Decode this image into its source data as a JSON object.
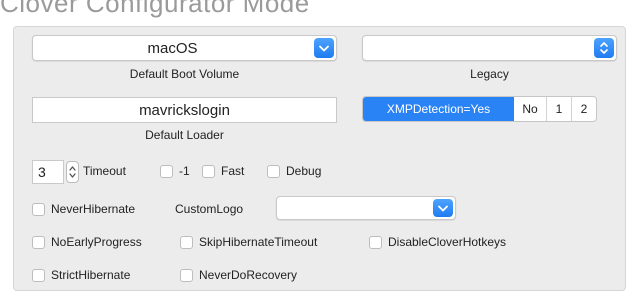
{
  "window": {
    "title": "Clover Configurator Mode"
  },
  "boot": {
    "volume_value": "macOS",
    "volume_caption": "Default Boot Volume",
    "legacy_value": "",
    "legacy_caption": "Legacy",
    "loader_value": "mavrickslogin",
    "loader_caption": "Default Loader"
  },
  "xmp": {
    "options": [
      "XMPDetection=Yes",
      "No",
      "1",
      "2"
    ],
    "selected": "XMPDetection=Yes"
  },
  "timeout": {
    "value": "3",
    "label": "Timeout",
    "minus_one_label": "-1",
    "fast_label": "Fast",
    "debug_label": "Debug"
  },
  "options": {
    "never_hibernate": "NeverHibernate",
    "custom_logo_label": "CustomLogo",
    "custom_logo_value": "",
    "no_early_progress": "NoEarlyProgress",
    "skip_hibernate_timeout": "SkipHibernateTimeout",
    "disable_clover_hotkeys": "DisableCloverHotkeys",
    "strict_hibernate": "StrictHibernate",
    "never_do_recovery": "NeverDoRecovery"
  },
  "colors": {
    "accent": "#2a83f4",
    "panel_bg": "#ececec"
  }
}
